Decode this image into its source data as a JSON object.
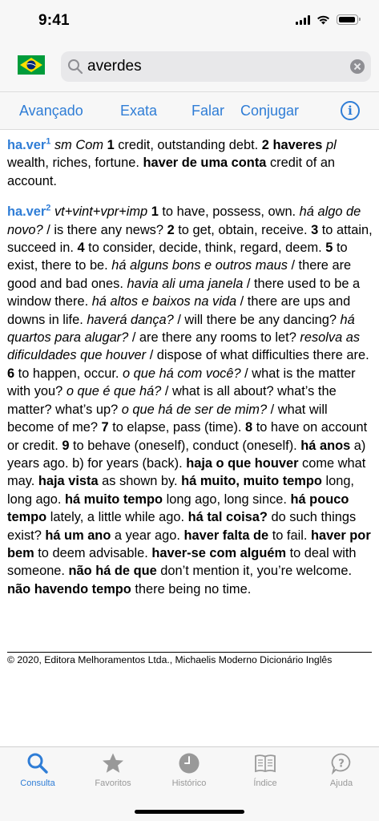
{
  "status": {
    "time": "9:41"
  },
  "search": {
    "value": "averdes",
    "flag": "brazil-flag"
  },
  "toolbar": {
    "avancado": "Avançado",
    "exata": "Exata",
    "falar": "Falar",
    "conjugar": "Conjugar",
    "info": "i"
  },
  "entries": [
    {
      "hw": "ha.ver",
      "sup": "1",
      "parts": [
        {
          "t": "gram",
          "s": "sm Com"
        },
        {
          "t": "text",
          "s": " "
        },
        {
          "t": "num",
          "s": "1"
        },
        {
          "t": "text",
          "s": " credit, outstanding debt. "
        },
        {
          "t": "num",
          "s": "2"
        },
        {
          "t": "text",
          "s": " "
        },
        {
          "t": "ph",
          "s": "haveres"
        },
        {
          "t": "text",
          "s": " "
        },
        {
          "t": "gram",
          "s": "pl"
        },
        {
          "t": "text",
          "s": " wealth, riches, fortune. "
        },
        {
          "t": "ph",
          "s": "haver de uma conta"
        },
        {
          "t": "text",
          "s": " credit of an account."
        }
      ]
    },
    {
      "hw": "ha.ver",
      "sup": "2",
      "parts": [
        {
          "t": "gram",
          "s": "vt+vint+vpr+imp"
        },
        {
          "t": "text",
          "s": " "
        },
        {
          "t": "num",
          "s": "1"
        },
        {
          "t": "text",
          "s": " to have, possess, own. "
        },
        {
          "t": "ex",
          "s": "há algo de novo?"
        },
        {
          "t": "text",
          "s": " / is there any news? "
        },
        {
          "t": "num",
          "s": "2"
        },
        {
          "t": "text",
          "s": " to get, obtain, receive. "
        },
        {
          "t": "num",
          "s": "3"
        },
        {
          "t": "text",
          "s": " to attain, succeed in. "
        },
        {
          "t": "num",
          "s": "4"
        },
        {
          "t": "text",
          "s": " to consider, decide, think, regard, deem. "
        },
        {
          "t": "num",
          "s": "5"
        },
        {
          "t": "text",
          "s": " to exist, there to be. "
        },
        {
          "t": "ex",
          "s": "há alguns bons e outros maus"
        },
        {
          "t": "text",
          "s": " / there are good and bad ones. "
        },
        {
          "t": "ex",
          "s": "havia ali uma janela"
        },
        {
          "t": "text",
          "s": " / there used to be a window there. "
        },
        {
          "t": "ex",
          "s": "há altos e baixos na vida"
        },
        {
          "t": "text",
          "s": " / there are ups and downs in life. "
        },
        {
          "t": "ex",
          "s": "haverá dança?"
        },
        {
          "t": "text",
          "s": " / will there be any dancing? "
        },
        {
          "t": "ex",
          "s": "há quartos para alugar?"
        },
        {
          "t": "text",
          "s": " / are there any rooms to let? "
        },
        {
          "t": "ex",
          "s": "resolva as dificuldades que houver"
        },
        {
          "t": "text",
          "s": " / dispose of what difficulties there are. "
        },
        {
          "t": "num",
          "s": "6"
        },
        {
          "t": "text",
          "s": " to happen, occur. "
        },
        {
          "t": "ex",
          "s": "o que há com você?"
        },
        {
          "t": "text",
          "s": " / what is the matter with you? "
        },
        {
          "t": "ex",
          "s": "o que é que há?"
        },
        {
          "t": "text",
          "s": " / what is all about? what’s the matter? what’s up? "
        },
        {
          "t": "ex",
          "s": "o que há de ser de mim?"
        },
        {
          "t": "text",
          "s": " / what will become of me? "
        },
        {
          "t": "num",
          "s": "7"
        },
        {
          "t": "text",
          "s": " to elapse, pass (time). "
        },
        {
          "t": "num",
          "s": "8"
        },
        {
          "t": "text",
          "s": " to have on account or credit. "
        },
        {
          "t": "num",
          "s": "9"
        },
        {
          "t": "text",
          "s": " to behave (oneself), conduct (oneself). "
        },
        {
          "t": "ph",
          "s": "há anos"
        },
        {
          "t": "text",
          "s": " a) years ago. b) for years (back). "
        },
        {
          "t": "ph",
          "s": "haja o que houver"
        },
        {
          "t": "text",
          "s": " come what may. "
        },
        {
          "t": "ph",
          "s": "haja vista"
        },
        {
          "t": "text",
          "s": " as shown by. "
        },
        {
          "t": "ph",
          "s": "há muito, muito tempo"
        },
        {
          "t": "text",
          "s": " long, long ago. "
        },
        {
          "t": "ph",
          "s": "há muito tempo"
        },
        {
          "t": "text",
          "s": " long ago, long since. "
        },
        {
          "t": "ph",
          "s": "há pouco tempo"
        },
        {
          "t": "text",
          "s": " lately, a little while ago. "
        },
        {
          "t": "ph",
          "s": "há tal coisa?"
        },
        {
          "t": "text",
          "s": " do such things exist? "
        },
        {
          "t": "ph",
          "s": "há um ano"
        },
        {
          "t": "text",
          "s": " a year ago. "
        },
        {
          "t": "ph",
          "s": "haver falta de"
        },
        {
          "t": "text",
          "s": " to fail. "
        },
        {
          "t": "ph",
          "s": "haver por bem"
        },
        {
          "t": "text",
          "s": " to deem advisable. "
        },
        {
          "t": "ph",
          "s": "haver-se com alguém"
        },
        {
          "t": "text",
          "s": " to deal with someone. "
        },
        {
          "t": "ph",
          "s": "não há de que"
        },
        {
          "t": "text",
          "s": " don’t mention it, you’re welcome. "
        },
        {
          "t": "ph",
          "s": "não havendo tempo"
        },
        {
          "t": "text",
          "s": " there being no time."
        }
      ]
    }
  ],
  "copyright": "© 2020, Editora Melhoramentos Ltda., Michaelis Moderno Dicionário Inglês",
  "tabs": [
    {
      "label": "Consulta",
      "icon": "search-icon",
      "active": true
    },
    {
      "label": "Favoritos",
      "icon": "star-icon",
      "active": false
    },
    {
      "label": "Histórico",
      "icon": "clock-icon",
      "active": false
    },
    {
      "label": "Índice",
      "icon": "book-icon",
      "active": false
    },
    {
      "label": "Ajuda",
      "icon": "help-icon",
      "active": false
    }
  ],
  "colors": {
    "accent": "#2f7dd6",
    "inactive": "#999999",
    "bar": "#f7f7f7"
  }
}
